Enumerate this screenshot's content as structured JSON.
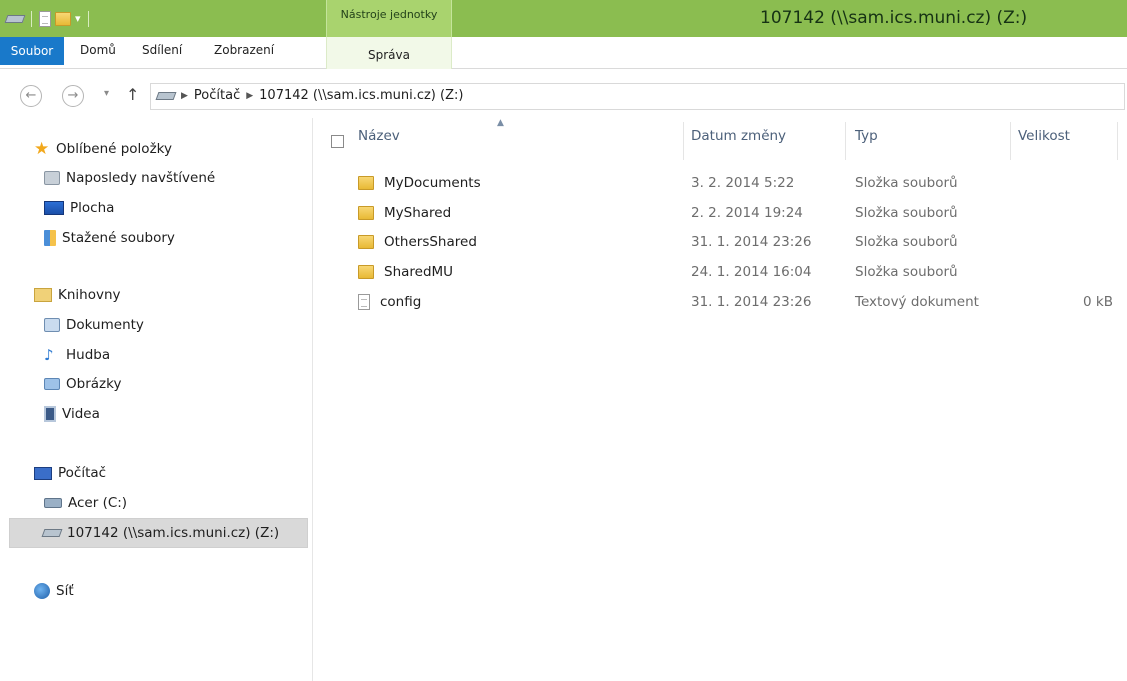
{
  "titlebar": {
    "title": "107142 (\\\\sam.ics.muni.cz) (Z:)",
    "context_tab_group": "Nástroje jednotky",
    "qat_dropdown": "▾"
  },
  "ribbon_tabs": {
    "file": "Soubor",
    "home": "Domů",
    "share": "Sdílení",
    "view": "Zobrazení",
    "manage": "Správa"
  },
  "navigation": {
    "back": "←",
    "forward": "→",
    "recent": "▾",
    "up": "↑",
    "breadcrumb": [
      "Počítač",
      "107142 (\\\\sam.ics.muni.cz) (Z:)"
    ],
    "separator": "▶"
  },
  "sidebar": {
    "favorites": {
      "label": "Oblíbené položky",
      "items": [
        {
          "label": "Naposledy navštívené"
        },
        {
          "label": "Plocha"
        },
        {
          "label": "Stažené soubory"
        }
      ]
    },
    "libraries": {
      "label": "Knihovny",
      "items": [
        {
          "label": "Dokumenty"
        },
        {
          "label": "Hudba"
        },
        {
          "label": "Obrázky"
        },
        {
          "label": "Videa"
        }
      ]
    },
    "computer": {
      "label": "Počítač",
      "items": [
        {
          "label": "Acer (C:)"
        },
        {
          "label": "107142 (\\\\sam.ics.muni.cz) (Z:)",
          "selected": true
        }
      ]
    },
    "network": {
      "label": "Síť"
    }
  },
  "columns": {
    "name": "Název",
    "date": "Datum změny",
    "type": "Typ",
    "size": "Velikost"
  },
  "files": [
    {
      "name": "MyDocuments",
      "date": "3. 2. 2014 5:22",
      "type": "Složka souborů",
      "size": "",
      "kind": "folder"
    },
    {
      "name": "MyShared",
      "date": "2. 2. 2014 19:24",
      "type": "Složka souborů",
      "size": "",
      "kind": "folder"
    },
    {
      "name": "OthersShared",
      "date": "31. 1. 2014 23:26",
      "type": "Složka souborů",
      "size": "",
      "kind": "folder"
    },
    {
      "name": "SharedMU",
      "date": "24. 1. 2014 16:04",
      "type": "Složka souborů",
      "size": "",
      "kind": "folder"
    },
    {
      "name": "config",
      "date": "31. 1. 2014 23:26",
      "type": "Textový dokument",
      "size": "0 kB",
      "kind": "file"
    }
  ],
  "colors": {
    "titlebar": "#8bbd50",
    "file_tab": "#1979ca",
    "header_text": "#4c607a"
  }
}
